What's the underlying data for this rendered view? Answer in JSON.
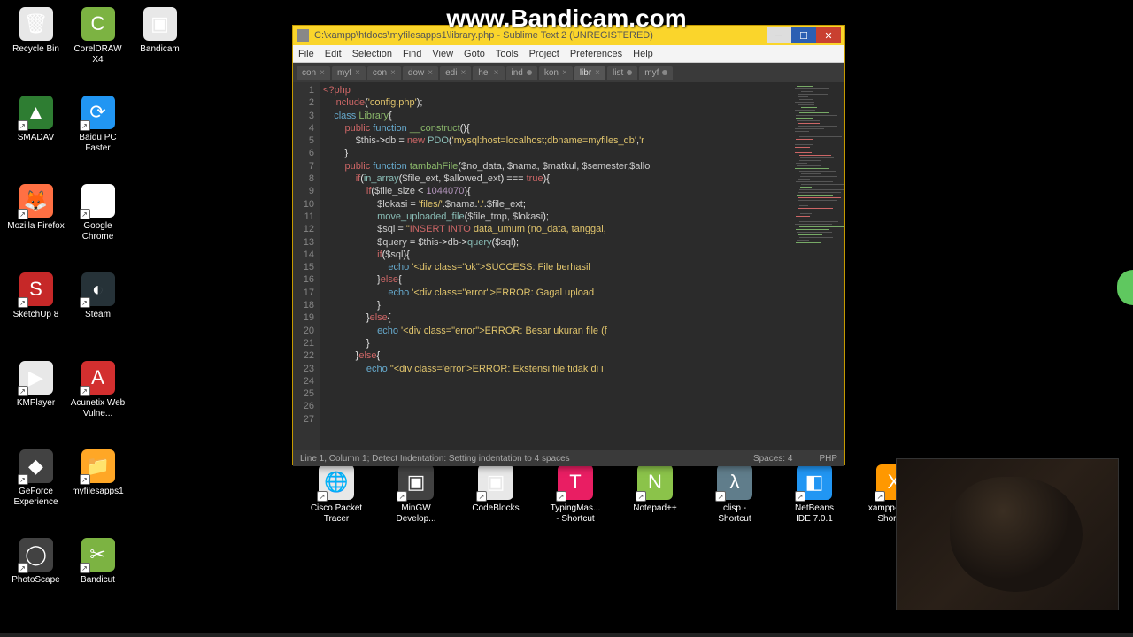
{
  "watermark": "www.Bandicam.com",
  "desktop_icons": [
    {
      "label": "Recycle Bin",
      "row": 0,
      "col": 0,
      "bg": "#e8e8e8",
      "glyph": "🗑"
    },
    {
      "label": "CorelDRAW X4",
      "row": 0,
      "col": 1,
      "bg": "#7cb342",
      "glyph": "C"
    },
    {
      "label": "Bandicam",
      "row": 0,
      "col": 2,
      "bg": "#e8e8e8",
      "glyph": "▣"
    },
    {
      "label": "SMADAV",
      "row": 1,
      "col": 0,
      "bg": "#2e7d32",
      "glyph": "▲"
    },
    {
      "label": "Baidu PC Faster",
      "row": 1,
      "col": 1,
      "bg": "#2196f3",
      "glyph": "⟳"
    },
    {
      "label": "Mozilla Firefox",
      "row": 2,
      "col": 0,
      "bg": "#ff7043",
      "glyph": "🦊"
    },
    {
      "label": "Google Chrome",
      "row": 2,
      "col": 1,
      "bg": "#fff",
      "glyph": "◉"
    },
    {
      "label": "SketchUp 8",
      "row": 3,
      "col": 0,
      "bg": "#c62828",
      "glyph": "S"
    },
    {
      "label": "Steam",
      "row": 3,
      "col": 1,
      "bg": "#263238",
      "glyph": "◐"
    },
    {
      "label": "KMPlayer",
      "row": 4,
      "col": 0,
      "bg": "#e8e8e8",
      "glyph": "▶"
    },
    {
      "label": "Acunetix Web Vulne...",
      "row": 4,
      "col": 1,
      "bg": "#d32f2f",
      "glyph": "A"
    },
    {
      "label": "GeForce Experience",
      "row": 5,
      "col": 0,
      "bg": "#424242",
      "glyph": "◆"
    },
    {
      "label": "myfilesapps1",
      "row": 5,
      "col": 1,
      "bg": "#ffa726",
      "glyph": "📁"
    },
    {
      "label": "PhotoScape",
      "row": 6,
      "col": 0,
      "bg": "#424242",
      "glyph": "◯"
    },
    {
      "label": "Bandicut",
      "row": 6,
      "col": 1,
      "bg": "#7cb342",
      "glyph": "✂"
    }
  ],
  "bottom_icons": [
    {
      "label": "Cisco Packet Tracer",
      "bg": "#e8e8e8",
      "glyph": "🌐"
    },
    {
      "label": "MinGW Develop...",
      "bg": "#424242",
      "glyph": "▣"
    },
    {
      "label": "CodeBlocks",
      "bg": "#e8e8e8",
      "glyph": "▣"
    },
    {
      "label": "TypingMas... - Shortcut",
      "bg": "#e91e63",
      "glyph": "T"
    },
    {
      "label": "Notepad++",
      "bg": "#8bc34a",
      "glyph": "N"
    },
    {
      "label": "clisp - Shortcut",
      "bg": "#607d8b",
      "glyph": "λ"
    },
    {
      "label": "NetBeans IDE 7.0.1",
      "bg": "#2196f3",
      "glyph": "◧"
    },
    {
      "label": "xampp-co... - Shortcut",
      "bg": "#ff9800",
      "glyph": "X"
    }
  ],
  "window": {
    "title": "C:\\xampp\\htdocs\\myfilesapps1\\library.php - Sublime Text 2 (UNREGISTERED)"
  },
  "menu": [
    "File",
    "Edit",
    "Selection",
    "Find",
    "View",
    "Goto",
    "Tools",
    "Project",
    "Preferences",
    "Help"
  ],
  "tabs": [
    {
      "label": "con",
      "mod": false
    },
    {
      "label": "myf",
      "mod": false
    },
    {
      "label": "con",
      "mod": false
    },
    {
      "label": "dow",
      "mod": false
    },
    {
      "label": "edi",
      "mod": false
    },
    {
      "label": "hel",
      "mod": false
    },
    {
      "label": "ind",
      "mod": true
    },
    {
      "label": "kon",
      "mod": false
    },
    {
      "label": "libr",
      "mod": false,
      "active": true
    },
    {
      "label": "list",
      "mod": true
    },
    {
      "label": "myf",
      "mod": true
    }
  ],
  "code_lines": [
    {
      "n": 1,
      "html": "<span class='k-keyword'>&lt;?php</span>"
    },
    {
      "n": 2,
      "html": "    <span class='k-keyword'>include</span>(<span class='k-string'>'config.php'</span>);"
    },
    {
      "n": 3,
      "html": "    <span class='k-keyword2'>class</span> <span class='k-funcname'>Library</span>{"
    },
    {
      "n": 4,
      "html": "        <span class='k-keyword'>public</span> <span class='k-keyword2'>function</span> <span class='k-funcname'>__construct</span>(){"
    },
    {
      "n": 5,
      "html": "            <span class='k-var'>$this</span>-&gt;<span class='k-var'>db</span> = <span class='k-keyword'>new</span> <span class='k-func'>PDO</span>(<span class='k-string'>'mysql:host=localhost;dbname=myfiles_db'</span>,<span class='k-string'>'r</span>"
    },
    {
      "n": 6,
      "html": "        }"
    },
    {
      "n": 7,
      "html": ""
    },
    {
      "n": 8,
      "html": "        <span class='k-keyword'>public</span> <span class='k-keyword2'>function</span> <span class='k-funcname'>tambahFile</span>(<span class='k-var'>$no_data, $nama, $matkul, $semester,$allo</span>"
    },
    {
      "n": 9,
      "html": ""
    },
    {
      "n": 10,
      "html": "            <span class='k-keyword'>if</span>(<span class='k-func'>in_array</span>(<span class='k-var'>$file_ext, $allowed_ext</span>) === <span class='k-keyword'>true</span>){"
    },
    {
      "n": 11,
      "html": "                <span class='k-keyword'>if</span>(<span class='k-var'>$file_size</span> &lt; <span class='k-num'>1044070</span>){"
    },
    {
      "n": 12,
      "html": "                    <span class='k-var'>$lokasi</span> = <span class='k-string'>'files/'</span>.<span class='k-var'>$nama</span>.<span class='k-string'>'.'</span>.<span class='k-var'>$file_ext</span>;"
    },
    {
      "n": 13,
      "html": "                    <span class='k-func'>move_uploaded_file</span>(<span class='k-var'>$file_tmp, $lokasi</span>);"
    },
    {
      "n": 14,
      "html": ""
    },
    {
      "n": 15,
      "html": ""
    },
    {
      "n": 16,
      "html": "                    <span class='k-var'>$sql</span> = <span class='k-string'>\"</span><span class='k-keyword'>INSERT INTO</span> <span class='k-string'>data_umum (no_data, tanggal,</span>"
    },
    {
      "n": 17,
      "html": "                    <span class='k-var'>$query</span> = <span class='k-var'>$this</span>-&gt;<span class='k-var'>db</span>-&gt;<span class='k-func'>query</span>(<span class='k-var'>$sql</span>);"
    },
    {
      "n": 18,
      "html": "                    <span class='k-keyword'>if</span>(<span class='k-var'>$sql</span>){"
    },
    {
      "n": 19,
      "html": "                        <span class='k-keyword2'>echo</span> <span class='k-string'>'&lt;div class=\"ok\"&gt;SUCCESS: File berhasil</span>"
    },
    {
      "n": 20,
      "html": "                    }<span class='k-keyword'>else</span>{"
    },
    {
      "n": 21,
      "html": "                        <span class='k-keyword2'>echo</span> <span class='k-string'>'&lt;div class=\"error\"&gt;ERROR: Gagal upload</span>"
    },
    {
      "n": 22,
      "html": "                    }"
    },
    {
      "n": 23,
      "html": "                }<span class='k-keyword'>else</span>{"
    },
    {
      "n": 24,
      "html": "                    <span class='k-keyword2'>echo</span> <span class='k-string'>'&lt;div class=\"error\"&gt;ERROR: Besar ukuran file (f</span>"
    },
    {
      "n": 25,
      "html": "                }"
    },
    {
      "n": 26,
      "html": "            }<span class='k-keyword'>else</span>{"
    },
    {
      "n": 27,
      "html": "                <span class='k-keyword2'>echo</span> <span class='k-string'>\"&lt;div class='error'&gt;ERROR: Ekstensi file tidak di i</span>"
    }
  ],
  "status": {
    "left": "Line 1, Column 1; Detect Indentation: Setting indentation to 4 spaces",
    "spaces": "Spaces: 4",
    "lang": "PHP"
  }
}
